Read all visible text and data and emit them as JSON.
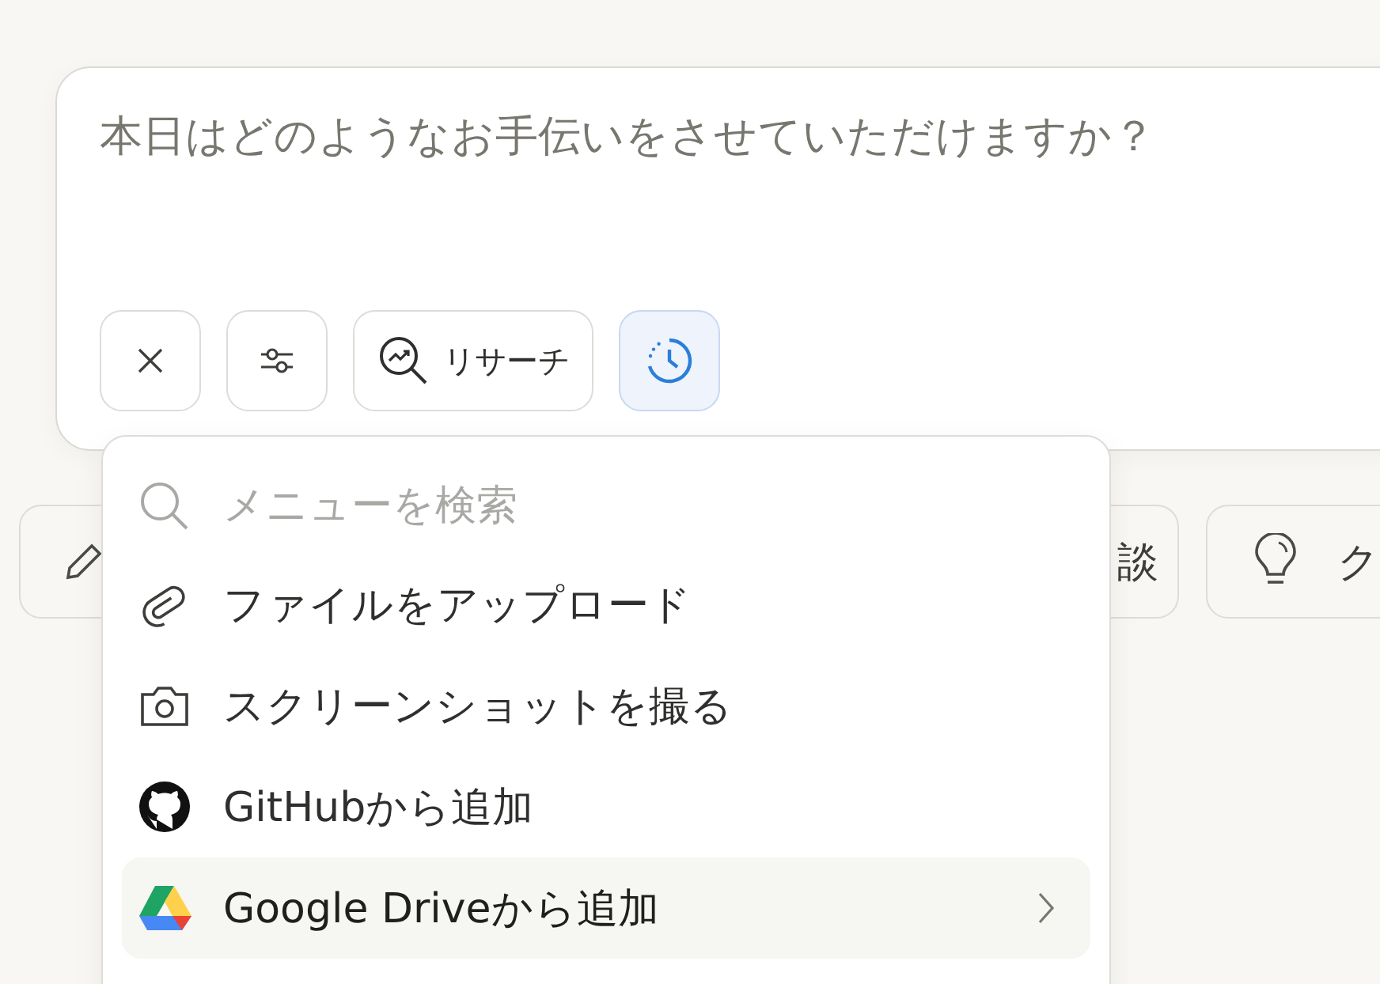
{
  "composer": {
    "placeholder": "本日はどのようなお手伝いをさせていただけますか？"
  },
  "toolbar": [
    {
      "kind": "close",
      "selected": false
    },
    {
      "kind": "settings",
      "selected": false
    },
    {
      "kind": "research",
      "label": "リサーチ",
      "selected": false
    },
    {
      "kind": "history",
      "selected": true
    }
  ],
  "chips": [
    {
      "kind": "pencil"
    },
    {
      "kind": "text",
      "label": "談"
    },
    {
      "kind": "bulb",
      "label": "ク"
    }
  ],
  "menu": {
    "search": {
      "placeholder": "メニューを検索"
    },
    "items": [
      {
        "kind": "clip",
        "label": "ファイルをアップロード",
        "selected": false,
        "submenu": false
      },
      {
        "kind": "camera",
        "label": "スクリーンショットを撮る",
        "selected": false,
        "submenu": false
      },
      {
        "kind": "github",
        "label": "GitHubから追加",
        "selected": false,
        "submenu": false
      },
      {
        "kind": "drive",
        "label": "Google Driveから追加",
        "selected": true,
        "submenu": true
      }
    ]
  }
}
